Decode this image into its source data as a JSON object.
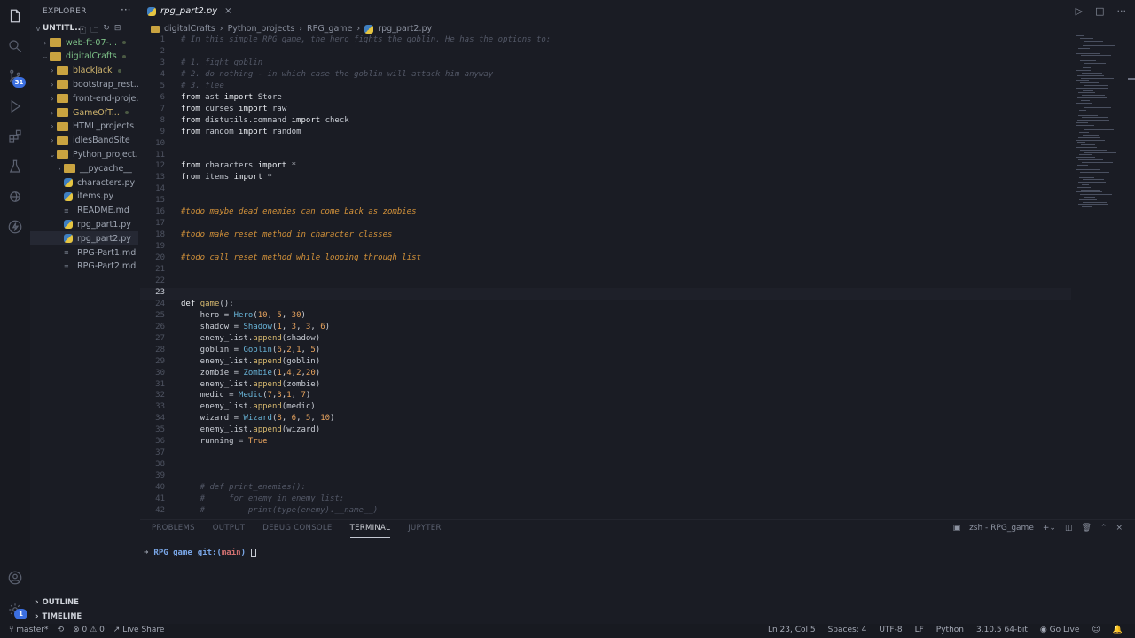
{
  "activity_bar": {
    "scm_badge": "31",
    "accounts_badge": "1"
  },
  "sidebar": {
    "title": "EXPLORER",
    "more": "···",
    "workspace": "UNTITL...",
    "tree": [
      {
        "label": "web-ft-07-...",
        "type": "folder",
        "depth": 1,
        "chevron": ">",
        "color": "green",
        "dot": true
      },
      {
        "label": "digitalCrafts",
        "type": "folder",
        "depth": 1,
        "chevron": "v",
        "color": "green",
        "dot": true
      },
      {
        "label": "blackJack",
        "type": "folder",
        "depth": 2,
        "chevron": ">",
        "color": "yellow",
        "dot": true
      },
      {
        "label": "bootstrap_rest...",
        "type": "folder",
        "depth": 2,
        "chevron": ">",
        "color": "plain",
        "dot": false
      },
      {
        "label": "front-end-proje...",
        "type": "folder",
        "depth": 2,
        "chevron": ">",
        "color": "plain",
        "dot": false
      },
      {
        "label": "GameOfT...",
        "type": "folder",
        "depth": 2,
        "chevron": ">",
        "color": "yellow",
        "dot": true
      },
      {
        "label": "HTML_projects",
        "type": "folder",
        "depth": 2,
        "chevron": ">",
        "color": "plain",
        "dot": false
      },
      {
        "label": "idlesBandSite",
        "type": "folder",
        "depth": 2,
        "chevron": ">",
        "color": "plain",
        "dot": false
      },
      {
        "label": "Python_project...",
        "type": "folder",
        "depth": 2,
        "chevron": "v",
        "color": "plain",
        "dot": false
      },
      {
        "label": "__pycache__",
        "type": "folder",
        "depth": 3,
        "chevron": ">",
        "color": "plain",
        "dot": false
      },
      {
        "label": "characters.py",
        "type": "py",
        "depth": 3,
        "chevron": "",
        "color": "plain",
        "dot": false
      },
      {
        "label": "items.py",
        "type": "py",
        "depth": 3,
        "chevron": "",
        "color": "plain",
        "dot": false
      },
      {
        "label": "README.md",
        "type": "md",
        "depth": 3,
        "chevron": "",
        "color": "plain",
        "dot": false
      },
      {
        "label": "rpg_part1.py",
        "type": "py",
        "depth": 3,
        "chevron": "",
        "color": "plain",
        "dot": false
      },
      {
        "label": "rpg_part2.py",
        "type": "py",
        "depth": 3,
        "chevron": "",
        "color": "plain",
        "dot": false,
        "selected": true
      },
      {
        "label": "RPG-Part1.md",
        "type": "md",
        "depth": 3,
        "chevron": "",
        "color": "plain",
        "dot": false
      },
      {
        "label": "RPG-Part2.md",
        "type": "md",
        "depth": 3,
        "chevron": "",
        "color": "plain",
        "dot": false
      }
    ],
    "outline": "OUTLINE",
    "timeline": "TIMELINE"
  },
  "editor": {
    "tab_label": "rpg_part2.py",
    "tab_close": "×",
    "breadcrumb": [
      "digitalCrafts",
      "Python_projects",
      "RPG_game",
      "rpg_part2.py"
    ],
    "current_line": 23,
    "lines": [
      {
        "n": "1",
        "t": [
          [
            "cmt",
            "# In this simple RPG game, the hero fights the goblin. He has the options to:"
          ]
        ]
      },
      {
        "n": "2",
        "t": []
      },
      {
        "n": "3",
        "t": [
          [
            "cmt",
            "# 1. fight goblin"
          ]
        ]
      },
      {
        "n": "4",
        "t": [
          [
            "cmt",
            "# 2. do nothing - in which case the goblin will attack him anyway"
          ]
        ]
      },
      {
        "n": "5",
        "t": [
          [
            "cmt",
            "# 3. flee"
          ]
        ]
      },
      {
        "n": "6",
        "t": [
          [
            "kw",
            "from"
          ],
          [
            "",
            " ast "
          ],
          [
            "kw",
            "import"
          ],
          [
            "",
            " Store"
          ]
        ]
      },
      {
        "n": "7",
        "t": [
          [
            "kw",
            "from"
          ],
          [
            "",
            " curses "
          ],
          [
            "kw",
            "import"
          ],
          [
            "",
            " raw"
          ]
        ]
      },
      {
        "n": "8",
        "t": [
          [
            "kw",
            "from"
          ],
          [
            "",
            " distutils.command "
          ],
          [
            "kw",
            "import"
          ],
          [
            "",
            " check"
          ]
        ]
      },
      {
        "n": "9",
        "t": [
          [
            "kw",
            "from"
          ],
          [
            "",
            " random "
          ],
          [
            "kw",
            "import"
          ],
          [
            "",
            " random"
          ]
        ]
      },
      {
        "n": "10",
        "t": []
      },
      {
        "n": "11",
        "t": []
      },
      {
        "n": "12",
        "t": [
          [
            "kw",
            "from"
          ],
          [
            "",
            " characters "
          ],
          [
            "kw",
            "import"
          ],
          [
            "",
            " *"
          ]
        ]
      },
      {
        "n": "13",
        "t": [
          [
            "kw",
            "from"
          ],
          [
            "",
            " items "
          ],
          [
            "kw",
            "import"
          ],
          [
            "",
            " *"
          ]
        ]
      },
      {
        "n": "14",
        "t": []
      },
      {
        "n": "15",
        "t": []
      },
      {
        "n": "16",
        "t": [
          [
            "todo",
            "#todo maybe dead enemies can come back as zombies"
          ]
        ]
      },
      {
        "n": "17",
        "t": []
      },
      {
        "n": "18",
        "t": [
          [
            "todo",
            "#todo make reset method in character classes"
          ]
        ]
      },
      {
        "n": "19",
        "t": []
      },
      {
        "n": "20",
        "t": [
          [
            "todo",
            "#todo call reset method while looping through list"
          ]
        ]
      },
      {
        "n": "21",
        "t": []
      },
      {
        "n": "22",
        "t": []
      },
      {
        "n": "23",
        "t": []
      },
      {
        "n": "24",
        "t": [
          [
            "kw",
            "def"
          ],
          [
            "",
            " "
          ],
          [
            "fn",
            "game"
          ],
          [
            "",
            "():"
          ]
        ]
      },
      {
        "n": "25",
        "t": [
          [
            "",
            "    hero = "
          ],
          [
            "cls",
            "Hero"
          ],
          [
            "",
            "("
          ],
          [
            "num",
            "10"
          ],
          [
            "",
            ", "
          ],
          [
            "num",
            "5"
          ],
          [
            "",
            ", "
          ],
          [
            "num",
            "30"
          ],
          [
            "",
            ")"
          ]
        ]
      },
      {
        "n": "26",
        "t": [
          [
            "",
            "    shadow = "
          ],
          [
            "cls",
            "Shadow"
          ],
          [
            "",
            "("
          ],
          [
            "num",
            "1"
          ],
          [
            "",
            ", "
          ],
          [
            "num",
            "3"
          ],
          [
            "",
            ", "
          ],
          [
            "num",
            "3"
          ],
          [
            "",
            ", "
          ],
          [
            "num",
            "6"
          ],
          [
            "",
            ")"
          ]
        ]
      },
      {
        "n": "27",
        "t": [
          [
            "",
            "    enemy_list."
          ],
          [
            "fn",
            "append"
          ],
          [
            "",
            "(shadow)"
          ]
        ]
      },
      {
        "n": "28",
        "t": [
          [
            "",
            "    goblin = "
          ],
          [
            "cls",
            "Goblin"
          ],
          [
            "",
            "("
          ],
          [
            "num",
            "6"
          ],
          [
            "",
            ","
          ],
          [
            "num",
            "2"
          ],
          [
            "",
            ","
          ],
          [
            "num",
            "1"
          ],
          [
            "",
            ", "
          ],
          [
            "num",
            "5"
          ],
          [
            "",
            ")"
          ]
        ]
      },
      {
        "n": "29",
        "t": [
          [
            "",
            "    enemy_list."
          ],
          [
            "fn",
            "append"
          ],
          [
            "",
            "(goblin)"
          ]
        ]
      },
      {
        "n": "30",
        "t": [
          [
            "",
            "    zombie = "
          ],
          [
            "cls",
            "Zombie"
          ],
          [
            "",
            "("
          ],
          [
            "num",
            "1"
          ],
          [
            "",
            ","
          ],
          [
            "num",
            "4"
          ],
          [
            "",
            ","
          ],
          [
            "num",
            "2"
          ],
          [
            "",
            ","
          ],
          [
            "num",
            "20"
          ],
          [
            "",
            ")"
          ]
        ]
      },
      {
        "n": "31",
        "t": [
          [
            "",
            "    enemy_list."
          ],
          [
            "fn",
            "append"
          ],
          [
            "",
            "(zombie)"
          ]
        ]
      },
      {
        "n": "32",
        "t": [
          [
            "",
            "    medic = "
          ],
          [
            "cls",
            "Medic"
          ],
          [
            "",
            "("
          ],
          [
            "num",
            "7"
          ],
          [
            "",
            ","
          ],
          [
            "num",
            "3"
          ],
          [
            "",
            ","
          ],
          [
            "num",
            "1"
          ],
          [
            "",
            ", "
          ],
          [
            "num",
            "7"
          ],
          [
            "",
            ")"
          ]
        ]
      },
      {
        "n": "33",
        "t": [
          [
            "",
            "    enemy_list."
          ],
          [
            "fn",
            "append"
          ],
          [
            "",
            "(medic)"
          ]
        ]
      },
      {
        "n": "34",
        "t": [
          [
            "",
            "    wizard = "
          ],
          [
            "cls",
            "Wizard"
          ],
          [
            "",
            "("
          ],
          [
            "num",
            "8"
          ],
          [
            "",
            ", "
          ],
          [
            "num",
            "6"
          ],
          [
            "",
            ", "
          ],
          [
            "num",
            "5"
          ],
          [
            "",
            ", "
          ],
          [
            "num",
            "10"
          ],
          [
            "",
            ")"
          ]
        ]
      },
      {
        "n": "35",
        "t": [
          [
            "",
            "    enemy_list."
          ],
          [
            "fn",
            "append"
          ],
          [
            "",
            "(wizard)"
          ]
        ]
      },
      {
        "n": "36",
        "t": [
          [
            "",
            "    running = "
          ],
          [
            "tru",
            "True"
          ]
        ]
      },
      {
        "n": "37",
        "t": []
      },
      {
        "n": "38",
        "t": []
      },
      {
        "n": "39",
        "t": []
      },
      {
        "n": "40",
        "t": [
          [
            "cmt",
            "    # def print_enemies():"
          ]
        ]
      },
      {
        "n": "41",
        "t": [
          [
            "cmt",
            "    #     for enemy in enemy_list:"
          ]
        ]
      },
      {
        "n": "42",
        "t": [
          [
            "cmt",
            "    #         print(type(enemy).__name__)"
          ]
        ]
      }
    ]
  },
  "panel": {
    "tabs": [
      "PROBLEMS",
      "OUTPUT",
      "DEBUG CONSOLE",
      "TERMINAL",
      "JUPYTER"
    ],
    "active_tab": "TERMINAL",
    "terminal_name": "zsh - RPG_game",
    "prompt_arrow": "➜",
    "prompt_dir": "RPG_game",
    "prompt_git": "git:(",
    "prompt_branch": "main",
    "prompt_git_close": ")"
  },
  "statusbar": {
    "branch": "master*",
    "errors": "0",
    "warnings": "0",
    "live_share": "Live Share",
    "position": "Ln 23, Col 5",
    "spaces": "Spaces: 4",
    "encoding": "UTF-8",
    "eol": "LF",
    "language": "Python",
    "interpreter": "3.10.5 64-bit",
    "go_live": "Go Live"
  }
}
